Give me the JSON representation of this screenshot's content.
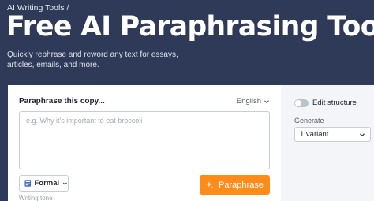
{
  "header": {
    "breadcrumb": "AI Writing Tools",
    "breadcrumb_separator": "/",
    "title": "Free AI Paraphrasing Tool",
    "subtitle": "Quickly rephrase and reword any text for essays, articles, emails, and more."
  },
  "editor": {
    "label": "Paraphrase this copy...",
    "language": "English",
    "placeholder": "e.g. Why it's important to eat broccoli",
    "value": "",
    "tone": "Formal",
    "tone_caption": "Writing tone",
    "submit_label": "Paraphrase"
  },
  "options": {
    "edit_structure_label": "Edit structure",
    "edit_structure_on": false,
    "generate_label": "Generate",
    "variant_selected": "1 variant"
  },
  "colors": {
    "hero_bg": "#2e3a57",
    "accent": "#ff8c1a"
  },
  "icons": {
    "language": "chevron-down-icon",
    "tone": "document-icon",
    "submit": "sparkle-icon",
    "variant": "chevron-down-icon"
  }
}
